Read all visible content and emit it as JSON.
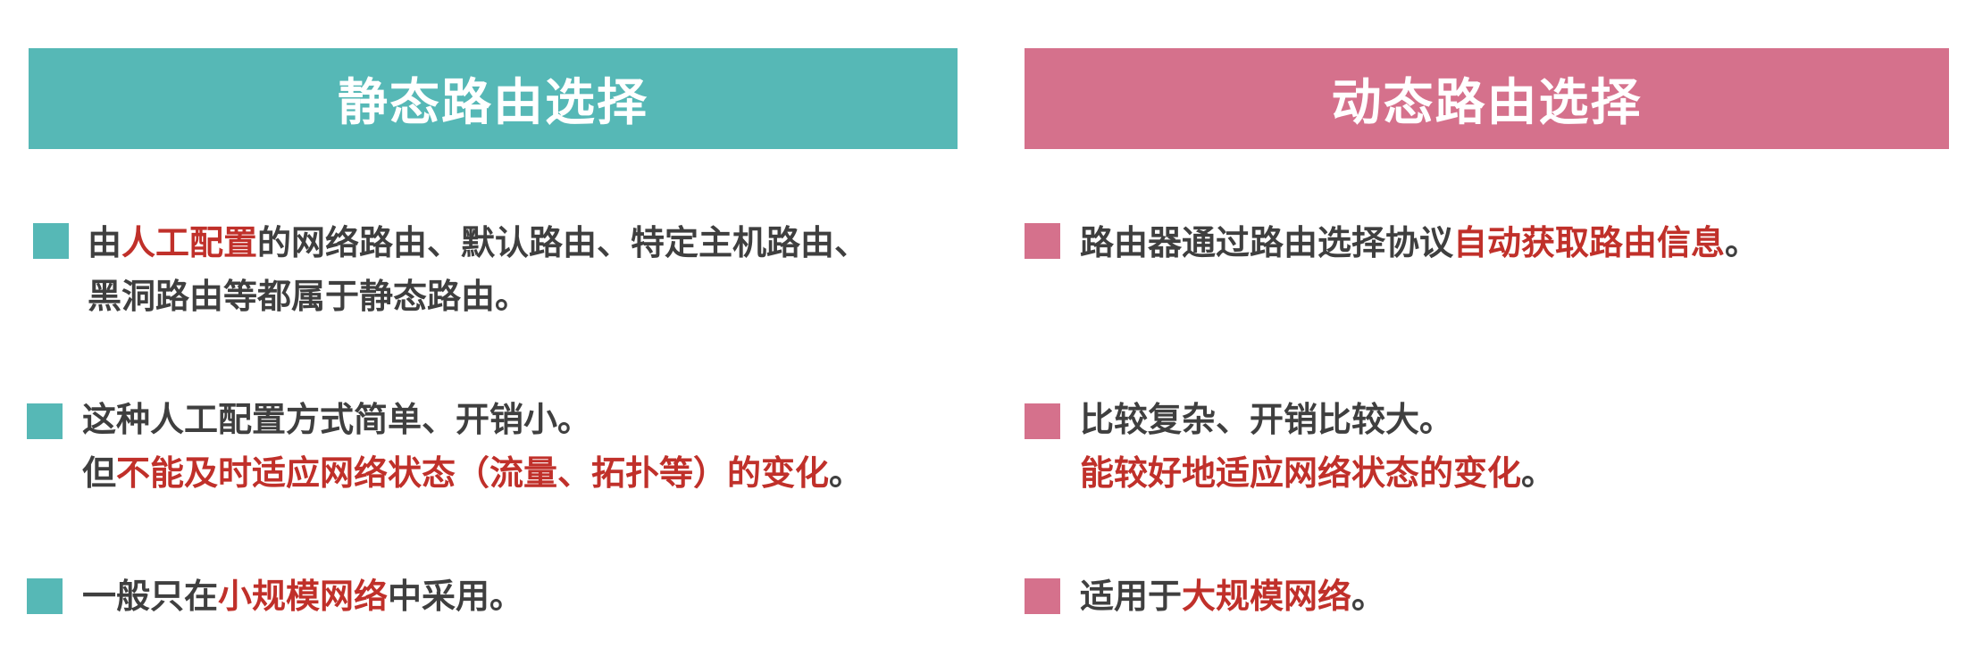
{
  "colors": {
    "static_accent": "#56b8b6",
    "dynamic_accent": "#d5718c",
    "highlight": "#c0302a",
    "body_text": "#3f3f3f"
  },
  "static": {
    "title": "静态路由选择",
    "items": [
      {
        "line1_a": "由",
        "line1_hl": "人工配置",
        "line1_b": "的网络路由、默认路由、特定主机路由、",
        "line2": "黑洞路由等都属于静态路由。"
      },
      {
        "line1": "这种人工配置方式简单、开销小。",
        "line2_a": "但",
        "line2_hl": "不能及时适应网络状态（流量、拓扑等）的变化",
        "line2_b": "。"
      },
      {
        "line1_a": "一般只在",
        "line1_hl": "小规模网络",
        "line1_b": "中采用。"
      }
    ]
  },
  "dynamic": {
    "title": "动态路由选择",
    "items": [
      {
        "line1_a": "路由器通过路由选择协议",
        "line1_hl": "自动获取路由信息",
        "line1_b": "。"
      },
      {
        "line1": "比较复杂、开销比较大。",
        "line2_hl": "能较好地适应网络状态的变化",
        "line2_b": "。"
      },
      {
        "line1_a": "适用于",
        "line1_hl": "大规模网络",
        "line1_b": "。"
      }
    ]
  }
}
